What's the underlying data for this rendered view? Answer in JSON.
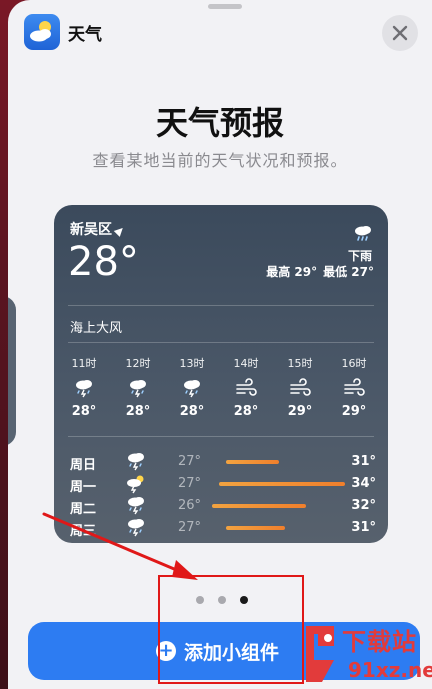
{
  "app": {
    "name": "天气",
    "icon": "weather-app-icon"
  },
  "header": {
    "title": "天气预报",
    "subtitle": "查看某地当前的天气状况和预报。"
  },
  "widget": {
    "location": "新吴区",
    "current_temp": "28°",
    "condition": "下雨",
    "high": "最高 29°",
    "low": "最低 27°",
    "alert": "海上大风",
    "hourly": [
      {
        "time": "11时",
        "icon": "thunderstorm-icon",
        "temp": "28°"
      },
      {
        "time": "12时",
        "icon": "thunderstorm-icon",
        "temp": "28°"
      },
      {
        "time": "13时",
        "icon": "thunderstorm-icon",
        "temp": "28°"
      },
      {
        "time": "14时",
        "icon": "wind-icon",
        "temp": "28°"
      },
      {
        "time": "15时",
        "icon": "wind-icon",
        "temp": "29°"
      },
      {
        "time": "16时",
        "icon": "wind-icon",
        "temp": "29°"
      }
    ],
    "daily": [
      {
        "day": "周日",
        "icon": "thunderstorm-icon",
        "low": "27°",
        "high": "31°",
        "range": [
          0.1,
          0.48
        ]
      },
      {
        "day": "周一",
        "icon": "sun-thunder-icon",
        "low": "27°",
        "high": "34°",
        "range": [
          0.05,
          0.95
        ]
      },
      {
        "day": "周二",
        "icon": "thunderstorm-icon",
        "low": "26°",
        "high": "32°",
        "range": [
          0.0,
          0.67
        ]
      },
      {
        "day": "周三",
        "icon": "thunderstorm-icon",
        "low": "27°",
        "high": "31°",
        "range": [
          0.1,
          0.52
        ]
      }
    ]
  },
  "pagination": {
    "count": 3,
    "active": 3
  },
  "add_button": {
    "label": "添加小组件"
  },
  "watermark": {
    "text": "下载站",
    "domain": "91xz.net"
  },
  "colors": {
    "button": "#2d7cf2",
    "annotation": "#e01818",
    "bar": "#f07f2c"
  }
}
